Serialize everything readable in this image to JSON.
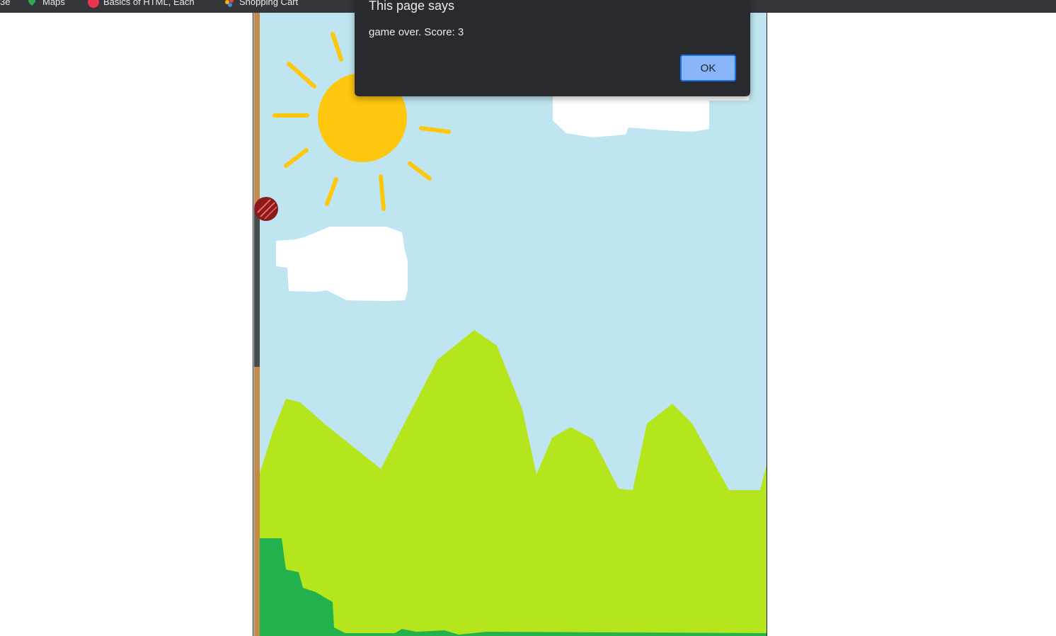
{
  "bookmarks": [
    {
      "label": "Maps",
      "icon": "maps-pin-icon"
    },
    {
      "label": "Basics of HTML, Each",
      "icon": "course-icon"
    },
    {
      "label": "Shopping Cart",
      "icon": "cart-icon"
    }
  ],
  "dialog": {
    "title": "This page says",
    "message": "game over. Score: 3",
    "ok_label": "OK"
  },
  "game": {
    "score": 3,
    "colors": {
      "sky": "#bfe6f0",
      "sun": "#fdc70e",
      "cloud": "#ffffff",
      "hills": "#b5e61d",
      "bushes": "#22b14c",
      "ball": "#8b1a1a",
      "paddle_rail": "#c48a49",
      "paddle": "#4a4a4a",
      "bookmark_bar": "#35363a",
      "dialog_bg": "#292a2d",
      "button": "#8ab4f8"
    }
  }
}
